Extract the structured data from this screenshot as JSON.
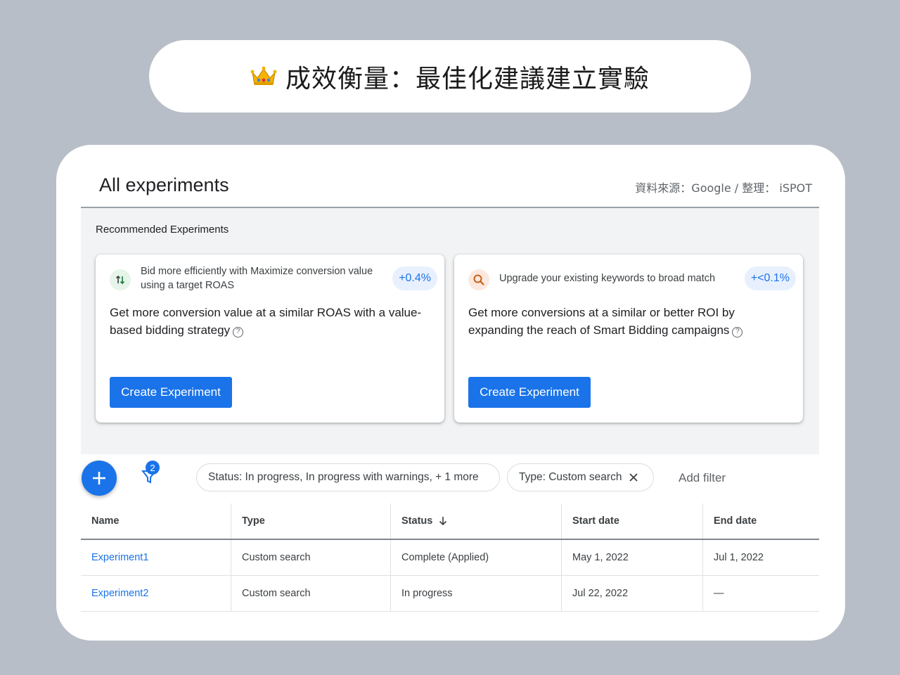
{
  "banner": {
    "icon": "crown-icon",
    "title": "成效衡量：最佳化建議建立實驗"
  },
  "header": {
    "page_title": "All experiments",
    "credit": "資料來源：Google / 整理： iSPOT"
  },
  "recommended": {
    "label": "Recommended Experiments",
    "cards": [
      {
        "icon": "bidding-arrows-icon",
        "subtitle": "Bid more efficiently with Maximize conversion value using a target ROAS",
        "badge": "+0.4%",
        "description": "Get more conversion value at a similar ROAS with a value-based bidding strategy",
        "button": "Create Experiment"
      },
      {
        "icon": "search-icon",
        "subtitle": "Upgrade your existing keywords to broad match",
        "badge": "+<0.1%",
        "description": "Get more conversions at a similar or better ROI by expanding the reach of Smart Bidding campaigns",
        "button": "Create Experiment"
      }
    ]
  },
  "toolbar": {
    "filter_count": "2",
    "status_chip": "Status: In progress, In progress with warnings, + 1 more",
    "type_chip": "Type: Custom search",
    "add_filter": "Add filter"
  },
  "table": {
    "columns": [
      "Name",
      "Type",
      "Status",
      "Start date",
      "End date"
    ],
    "rows": [
      [
        "Experiment1",
        "Custom search",
        "Complete (Applied)",
        "May 1, 2022",
        "Jul 1, 2022"
      ],
      [
        "Experiment2",
        "Custom search",
        "In progress",
        "Jul 22, 2022",
        "—"
      ]
    ]
  },
  "colors": {
    "background": "#b8bec7",
    "accent": "#1a73e8",
    "badge_bg": "#e8f0fe"
  }
}
